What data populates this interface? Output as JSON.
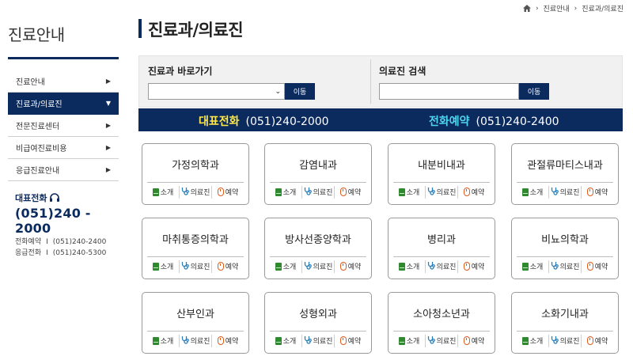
{
  "sidebar": {
    "title": "진료안내",
    "items": [
      {
        "label": "진료안내",
        "active": false
      },
      {
        "label": "진료과/의료진",
        "active": true
      },
      {
        "label": "전문진료센터",
        "active": false
      },
      {
        "label": "비급여진료비용",
        "active": false
      },
      {
        "label": "응급진료안내",
        "active": false
      }
    ],
    "phone_label": "대표전화",
    "phone_number": "(051)240 - 2000",
    "reserve_label": "전화예약",
    "reserve_number": "(051)240-2400",
    "emergency_label": "응급전화",
    "emergency_number": "(051)240-5300",
    "separator": "I"
  },
  "breadcrumb": [
    "진료안내",
    "진료과/의료진"
  ],
  "page_title": "진료과/의료진",
  "search": {
    "dept_label": "진료과 바로가기",
    "dept_selected": "",
    "dept_button": "이동",
    "doctor_label": "의료진 검색",
    "doctor_value": "",
    "doctor_button": "이동"
  },
  "phone_bar": {
    "main_label": "대표전화",
    "main_number": "(051)240-2000",
    "reserve_label": "전화예약",
    "reserve_number": "(051)240-2400"
  },
  "card_actions": {
    "intro": "소개",
    "doctors": "의료진",
    "reserve": "예약"
  },
  "departments": [
    "가정의학과",
    "감염내과",
    "내분비내과",
    "관절류마티스내과",
    "마취통증의학과",
    "방사선종양학과",
    "병리과",
    "비뇨의학과",
    "산부인과",
    "성형외과",
    "소아청소년과",
    "소화기내과"
  ],
  "colors": {
    "navy": "#0b2a5e",
    "main_phone_label": "#ffe94a",
    "reserve_phone_label": "#4fd6f0",
    "intro_icon": "#2f8a2f",
    "doctors_icon": "#2a7fb8",
    "reserve_icon": "#e05a1a"
  }
}
